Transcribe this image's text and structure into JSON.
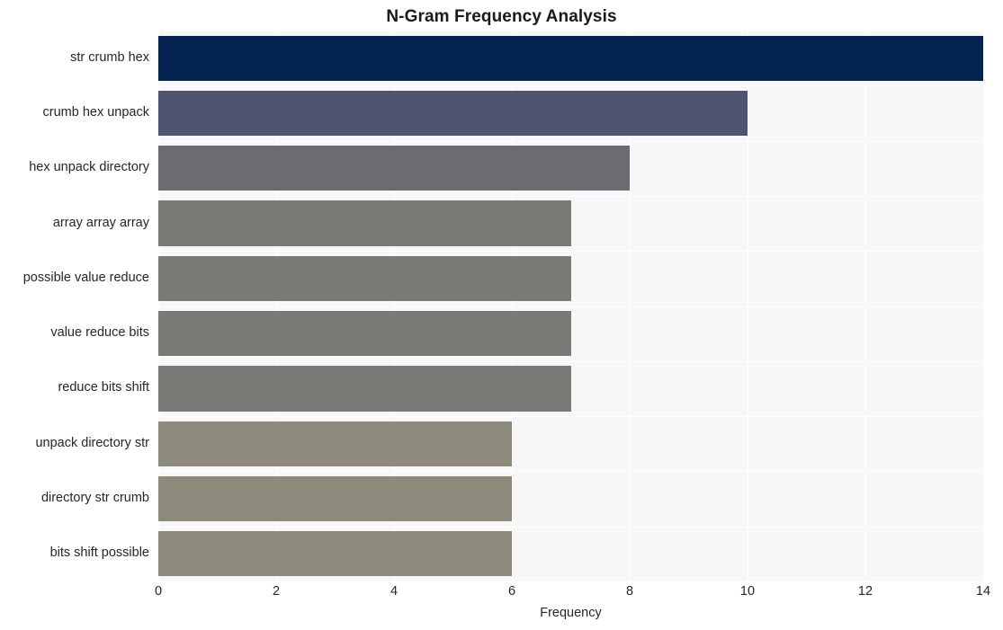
{
  "chart_data": {
    "type": "bar",
    "orientation": "horizontal",
    "title": "N-Gram Frequency Analysis",
    "xlabel": "Frequency",
    "ylabel": "",
    "xlim": [
      0,
      14
    ],
    "xticks": [
      0,
      2,
      4,
      6,
      8,
      10,
      12,
      14
    ],
    "grid": true,
    "legend": null,
    "categories": [
      "str crumb hex",
      "crumb hex unpack",
      "hex unpack directory",
      "array array array",
      "possible value reduce",
      "value reduce bits",
      "reduce bits shift",
      "unpack directory str",
      "directory str crumb",
      "bits shift possible"
    ],
    "values": [
      14,
      10,
      8,
      7,
      7,
      7,
      7,
      6,
      6,
      6
    ],
    "bar_colors": [
      "#042350",
      "#4f5570",
      "#6a6c72",
      "#7b7a77",
      "#7b7a77",
      "#7b7a77",
      "#7b7a77",
      "#8e8a7b",
      "#8e8a7b",
      "#8e8a7b"
    ]
  },
  "style": {
    "plot_background": "#f7f7f7",
    "figure_background": "#ffffff",
    "grid_color": "#ffffff",
    "text_color": "#262626",
    "title_color": "#1a1a1a"
  }
}
